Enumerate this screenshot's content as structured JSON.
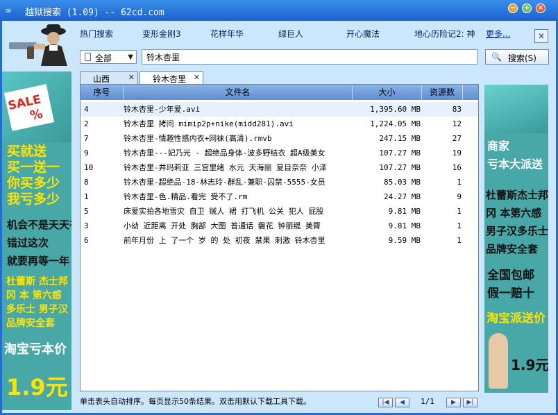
{
  "window": {
    "title": "越狱搜索 (1.09) -- 62cd.com"
  },
  "nav": {
    "links": [
      "热门搜索",
      "变形金刚3",
      "花样年华",
      "绿巨人",
      "开心魔法",
      "地心历险记2: 神"
    ],
    "more": "更多..."
  },
  "search": {
    "category": "全部",
    "query": "铃木杏里",
    "button": "搜索(S)"
  },
  "tabs": [
    {
      "label": "山西",
      "active": false
    },
    {
      "label": "铃木杏里",
      "active": true
    }
  ],
  "table": {
    "columns": [
      "序号",
      "文件名",
      "大小",
      "资源数"
    ],
    "rows": [
      {
        "no": "4",
        "name": "铃木杏里-少年爱.avi",
        "size": "1,395.60 MB",
        "sources": "83"
      },
      {
        "no": "2",
        "name": "铃木杏里 拷问 mimip2p+nike(midd281).avi",
        "size": "1,224.05 MB",
        "sources": "12"
      },
      {
        "no": "7",
        "name": "铃木杏里-情趣性感内衣+网袜(高清).rmvb",
        "size": "247.15 MB",
        "sources": "27"
      },
      {
        "no": "9",
        "name": "铃木杏里---妃乃光 - 超绝品身体-波多野结衣 超A级美女",
        "size": "107.27 MB",
        "sources": "19"
      },
      {
        "no": "10",
        "name": "铃木杏里-井玛莉亚 三宫里绪 水元 天海丽 夏目奈奈 小泽",
        "size": "107.27 MB",
        "sources": "16"
      },
      {
        "no": "8",
        "name": "铃木杏里-超绝品-18-林志玲-群乱-兼职-囚禁-5555-女员",
        "size": "85.03 MB",
        "sources": "1"
      },
      {
        "no": "1",
        "name": "铃木杏里-色.精品.看完 受不了.rm",
        "size": "24.27 MB",
        "sources": "9"
      },
      {
        "no": "5",
        "name": "床爱实拍各地雪灾 自卫 贼人 裙 打飞机 公关 犯人 屁股",
        "size": "9.81 MB",
        "sources": "1"
      },
      {
        "no": "3",
        "name": "小幼 近距离 开处 胸部 大图 普通话 磐花 钟丽缇 美臀",
        "size": "9.81 MB",
        "sources": "1"
      },
      {
        "no": "6",
        "name": "前年月份 上 了一个 岁 的 处 初夜 禁果 刺激 铃木杏里",
        "size": "9.59 MB",
        "sources": "1"
      }
    ]
  },
  "status": {
    "text": "单击表头自动排序。每页显示50条结果。双击用默认下载工具下载。",
    "page": "1/1"
  },
  "ads": {
    "left": {
      "sale": "SALE",
      "percent": "%",
      "lines1": [
        "买就送",
        "买一送一",
        "你买多少",
        "我亏多少"
      ],
      "lines2": [
        "机会不是天天有",
        "错过这次",
        "就要再等一年"
      ],
      "lines3": [
        "杜蕾斯 杰士邦",
        "冈 本 第六感",
        "多乐士 男子汉",
        "品牌安全套"
      ],
      "slogan": "淘宝亏本价",
      "price": "1.9元"
    },
    "right": {
      "lines1": [
        "商家",
        "亏本大派送"
      ],
      "lines2": [
        "杜蕾斯杰士邦",
        "冈 本第六感",
        "男子汉多乐士",
        "品牌安全套"
      ],
      "lines3": [
        "全国包邮",
        "假一赔十"
      ],
      "slogan": "淘宝派送价",
      "price": "1.9元"
    }
  },
  "colors": {
    "titlebar": "#2a7ae0",
    "client": "#cce6fb",
    "header": "#6f9ddb",
    "ad_bg": "#48a8a8",
    "ad_yellow": "#ffe400"
  }
}
